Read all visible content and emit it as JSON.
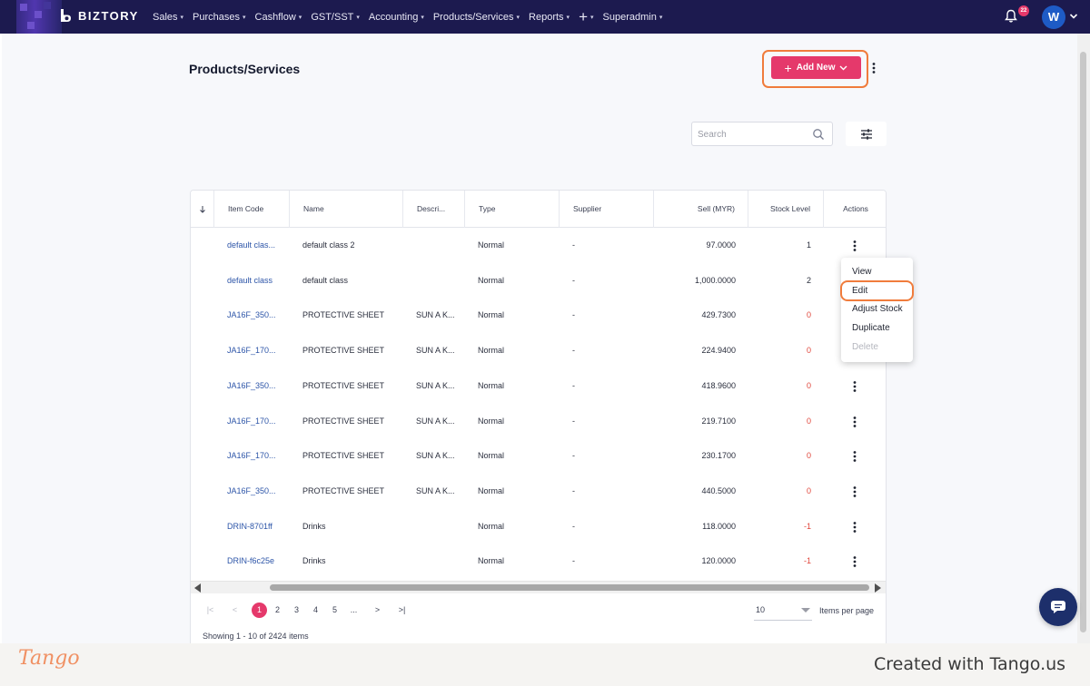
{
  "app": {
    "brand": "BIZTORY",
    "notification_count": "22",
    "avatar_initial": "W"
  },
  "nav": [
    {
      "label": "Sales",
      "has_caret": true
    },
    {
      "label": "Purchases",
      "has_caret": true
    },
    {
      "label": "Cashflow",
      "has_caret": true
    },
    {
      "label": "GST/SST",
      "has_caret": true
    },
    {
      "label": "Accounting",
      "has_caret": true
    },
    {
      "label": "Products/Services",
      "has_caret": true
    },
    {
      "label": "Reports",
      "has_caret": true
    },
    {
      "label": "+",
      "has_caret": true
    },
    {
      "label": "Superadmin",
      "has_caret": true
    }
  ],
  "page": {
    "title": "Products/Services",
    "add_new_label": "Add New"
  },
  "search": {
    "placeholder": "Search",
    "value": ""
  },
  "table": {
    "sort_icon": "arrow-down-icon",
    "columns": [
      "Item Code",
      "Name",
      "Descri...",
      "Type",
      "Supplier",
      "Sell (MYR)",
      "Stock Level",
      "Actions"
    ],
    "rows": [
      {
        "code": "default clas...",
        "name": "default class 2",
        "desc": "",
        "type": "Normal",
        "supplier": "-",
        "sell": "97.0000",
        "stock": "1",
        "stock_neg": false
      },
      {
        "code": "default class",
        "name": "default class",
        "desc": "",
        "type": "Normal",
        "supplier": "-",
        "sell": "1,000.0000",
        "stock": "2",
        "stock_neg": false
      },
      {
        "code": "JA16F_350...",
        "name": "PROTECTIVE SHEET",
        "desc": "SUN A K...",
        "type": "Normal",
        "supplier": "-",
        "sell": "429.7300",
        "stock": "0",
        "stock_neg": true
      },
      {
        "code": "JA16F_170...",
        "name": "PROTECTIVE SHEET",
        "desc": "SUN A K...",
        "type": "Normal",
        "supplier": "-",
        "sell": "224.9400",
        "stock": "0",
        "stock_neg": true
      },
      {
        "code": "JA16F_350...",
        "name": "PROTECTIVE SHEET",
        "desc": "SUN A K...",
        "type": "Normal",
        "supplier": "-",
        "sell": "418.9600",
        "stock": "0",
        "stock_neg": true
      },
      {
        "code": "JA16F_170...",
        "name": "PROTECTIVE SHEET",
        "desc": "SUN A K...",
        "type": "Normal",
        "supplier": "-",
        "sell": "219.7100",
        "stock": "0",
        "stock_neg": true
      },
      {
        "code": "JA16F_170...",
        "name": "PROTECTIVE SHEET",
        "desc": "SUN A K...",
        "type": "Normal",
        "supplier": "-",
        "sell": "230.1700",
        "stock": "0",
        "stock_neg": true
      },
      {
        "code": "JA16F_350...",
        "name": "PROTECTIVE SHEET",
        "desc": "SUN A K...",
        "type": "Normal",
        "supplier": "-",
        "sell": "440.5000",
        "stock": "0",
        "stock_neg": true
      },
      {
        "code": "DRIN-8701ff",
        "name": "Drinks",
        "desc": "",
        "type": "Normal",
        "supplier": "-",
        "sell": "118.0000",
        "stock": "-1",
        "stock_neg": true
      },
      {
        "code": "DRIN-f6c25e",
        "name": "Drinks",
        "desc": "",
        "type": "Normal",
        "supplier": "-",
        "sell": "120.0000",
        "stock": "-1",
        "stock_neg": true
      }
    ]
  },
  "context_menu": {
    "items": [
      {
        "label": "View",
        "disabled": false
      },
      {
        "label": "Edit",
        "disabled": false
      },
      {
        "label": "Adjust Stock",
        "disabled": false
      },
      {
        "label": "Duplicate",
        "disabled": false
      },
      {
        "label": "Delete",
        "disabled": true
      }
    ]
  },
  "pagination": {
    "first": "|<",
    "prev": "<",
    "pages": [
      "1",
      "2",
      "3",
      "4",
      "5"
    ],
    "current": "1",
    "ellipsis": "...",
    "next": ">",
    "last": ">|",
    "per_page_value": "10",
    "per_page_label": "Items per page",
    "showing_text": "Showing 1 - 10 of 2424 items"
  },
  "footer": {
    "logo": "Tango",
    "credit": "Created with Tango.us"
  },
  "colors": {
    "navbar": "#1c1a4f",
    "accent": "#e5396b",
    "highlight": "#f07c3c",
    "link": "#2d55a8",
    "negative": "#e0453a"
  }
}
